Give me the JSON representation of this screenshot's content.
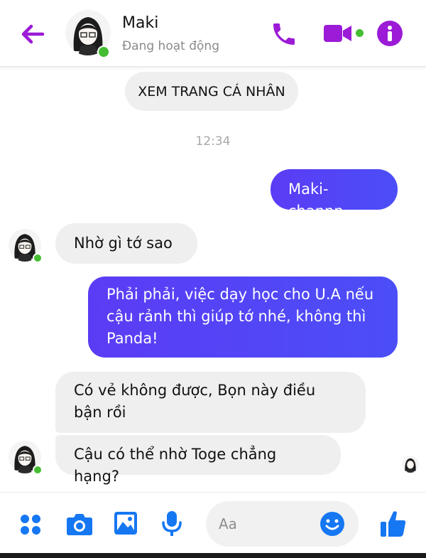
{
  "header": {
    "contact_name": "Maki",
    "status": "Đang hoạt động",
    "icons": [
      "back-arrow-icon",
      "phone-icon",
      "video-camera-icon",
      "info-icon"
    ],
    "accent_color": "#9b1bd6"
  },
  "conversation": {
    "profile_button": "XEM TRANG CÁ NHÂN",
    "timestamp": "12:34",
    "messages": [
      {
        "from": "me",
        "text": "Maki-channn"
      },
      {
        "from": "them",
        "text": "Nhờ gì tớ sao"
      },
      {
        "from": "me",
        "text": "Phải phải, việc dạy học cho U.A nếu cậu rảnh thì giúp tớ nhé, không thì Panda!"
      },
      {
        "from": "them",
        "text": "Có vẻ không được, Bọn này điều bận rồi"
      },
      {
        "from": "them",
        "text": "Cậu có thể nhờ Toge chẳng hạng?"
      }
    ],
    "colors": {
      "sent_bubble": "#5b3cf5",
      "received_bubble": "#efefef",
      "online": "#44bd32"
    }
  },
  "composer": {
    "placeholder": "Aa",
    "icons": [
      "apps-icon",
      "camera-icon",
      "gallery-icon",
      "microphone-icon",
      "emoji-icon",
      "thumbs-up-icon"
    ],
    "icon_color": "#1677f2"
  }
}
